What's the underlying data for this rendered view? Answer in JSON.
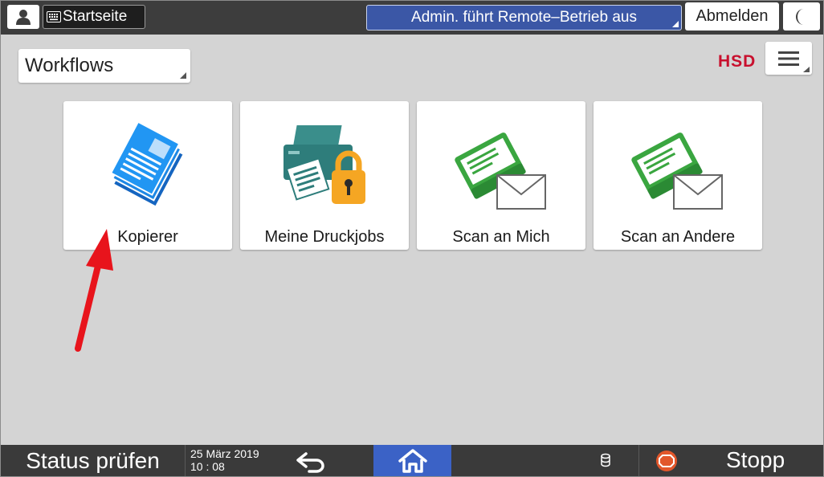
{
  "topbar": {
    "user_icon": "user-icon",
    "home_label": "Startseite",
    "remote_banner": "Admin. führt Remote–Betrieb aus",
    "logout_label": "Abmelden",
    "night_icon": "moon-icon"
  },
  "header": {
    "workflow_select": "Workflows",
    "logo_text": "HSD",
    "menu_icon": "hamburger-menu-icon"
  },
  "tiles": [
    {
      "label": "Kopierer",
      "icon": "copier-documents-icon"
    },
    {
      "label": "Meine Druckjobs",
      "icon": "printer-lock-icon"
    },
    {
      "label": "Scan an Mich",
      "icon": "scanner-mail-icon"
    },
    {
      "label": "Scan an Andere",
      "icon": "scanner-mail-icon"
    }
  ],
  "bottombar": {
    "status_label": "Status prüfen",
    "date": "25 März 2019",
    "time": "10 : 08",
    "back_icon": "back-arrow-icon",
    "home_icon": "home-icon",
    "storage_icon": "storage-icon",
    "stop_label": "Stopp"
  },
  "colors": {
    "accent_blue": "#3b62c6",
    "banner_blue": "#3b57a6",
    "logo_red": "#c8102e",
    "copier_blue": "#1e88e5",
    "printer_teal": "#2e7d7b",
    "lock_orange": "#f5a623",
    "scanner_green": "#3aa640",
    "annotation_red": "#e8141c"
  }
}
